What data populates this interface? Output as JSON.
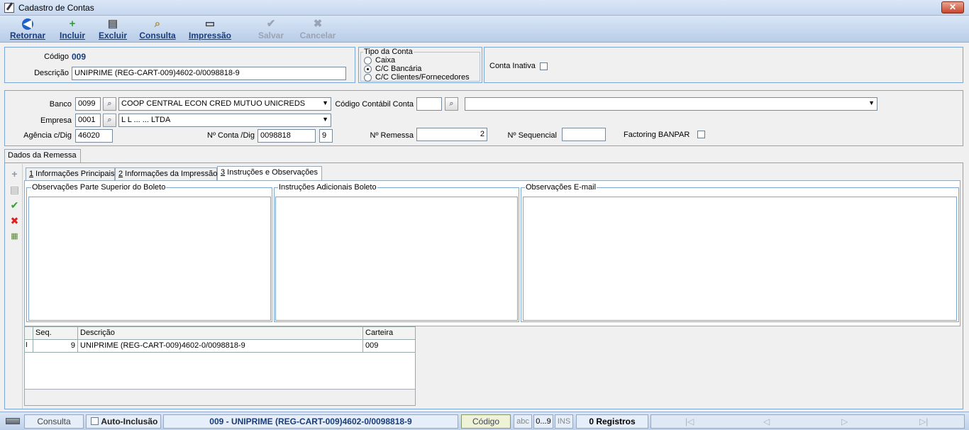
{
  "window": {
    "title": "Cadastro de Contas",
    "close_label": "✕"
  },
  "toolbar": {
    "retornar": "Retornar",
    "incluir": "Incluir",
    "excluir": "Excluir",
    "consulta": "Consulta",
    "impressao": "Impressão",
    "salvar": "Salvar",
    "cancelar": "Cancelar"
  },
  "header": {
    "codigo_label": "Código",
    "codigo_value": "009",
    "descricao_label": "Descrição",
    "descricao_value": "UNIPRIME (REG-CART-009)4602-0/0098818-9",
    "tipo_conta": {
      "title": "Tipo da Conta",
      "options": [
        "Caixa",
        "C/C Bancária",
        "C/C Clientes/Fornecedores"
      ],
      "selected": "C/C Bancária"
    },
    "conta_inativa_label": "Conta Inativa"
  },
  "details": {
    "banco_label": "Banco",
    "banco_code": "0099",
    "banco_name": "COOP CENTRAL ECON CRED MUTUO UNICREDS",
    "empresa_label": "Empresa",
    "empresa_code": "0001",
    "empresa_name": "L L ... ...  LTDA",
    "agencia_label": "Agência c/Dig",
    "agencia_value": "46020",
    "conta_label": "Nº Conta /Dig",
    "conta_value": "0098818",
    "conta_dig": "9",
    "codigo_contabil_label": "Código Contábil Conta",
    "codigo_contabil_value": "",
    "codigo_contabil_desc": "",
    "remessa_label": "Nº Remessa",
    "remessa_value": "2",
    "sequencial_label": "Nº Sequencial",
    "sequencial_value": "",
    "factoring_label": "Factoring BANPAR"
  },
  "main_tab": "Dados da Remessa",
  "sub_tabs": [
    {
      "num": "1",
      "label": " Informações Principais"
    },
    {
      "num": "2",
      "label": " Informações da Impressão"
    },
    {
      "num": "3",
      "label": " Instruções e Observações"
    }
  ],
  "memos": {
    "obs_superior": "Observações Parte Superior do Boleto",
    "instrucoes": "Instruções Adicionais Boleto",
    "obs_email": "Observações E-mail"
  },
  "grid": {
    "columns": [
      "Seq.",
      "Descrição",
      "Carteira"
    ],
    "rows": [
      {
        "indicator": "I",
        "seq": "9",
        "descricao": "UNIPRIME (REG-CART-009)4602-0/0098818-9",
        "carteira": "009"
      }
    ]
  },
  "status": {
    "mode": "Consulta",
    "auto_inclusao": "Auto-Inclusão",
    "record": "009 - UNIPRIME (REG-CART-009)4602-0/0098818-9",
    "order_field": "Código",
    "abc": "abc",
    "num": "0...9",
    "ins": "INS",
    "registros": "0 Registros"
  },
  "colors": {
    "accent": "#1a3c7a",
    "panel_border": "#7aa7d6",
    "status_field": "#1a3c7a"
  }
}
